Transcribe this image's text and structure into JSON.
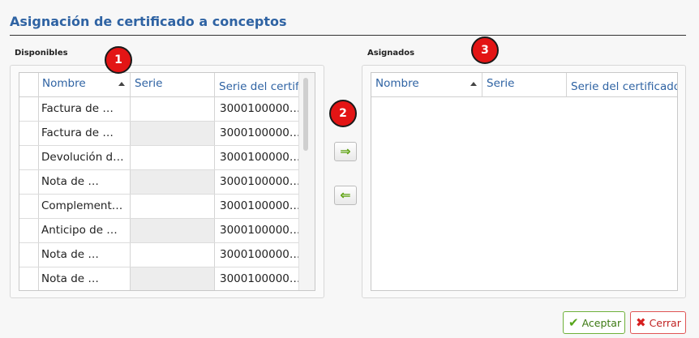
{
  "header": {
    "title": "Asignación de certificado a conceptos"
  },
  "available": {
    "label": "Disponibles",
    "columns": [
      "Nombre",
      "Serie",
      "Serie del certifi"
    ],
    "rows": [
      {
        "name": "Factura de …",
        "serie": "",
        "cert": "3000100000…"
      },
      {
        "name": "Factura de …",
        "serie": "",
        "cert": "3000100000…"
      },
      {
        "name": "Devolución d…",
        "serie": "",
        "cert": "3000100000…"
      },
      {
        "name": "Nota de …",
        "serie": "",
        "cert": "3000100000…"
      },
      {
        "name": "Complement…",
        "serie": "",
        "cert": "3000100000…"
      },
      {
        "name": "Anticipo de …",
        "serie": "",
        "cert": "3000100000…"
      },
      {
        "name": "Nota de …",
        "serie": "",
        "cert": "3000100000…"
      },
      {
        "name": "Nota de …",
        "serie": "",
        "cert": "3000100000…"
      }
    ]
  },
  "assigned": {
    "label": "Asignados",
    "columns": [
      "Nombre",
      "Serie",
      "Serie del certificado"
    ],
    "rows": []
  },
  "badges": [
    "1",
    "2",
    "3"
  ],
  "transfer": {
    "add_icon": "arrow-right-icon",
    "remove_icon": "arrow-left-icon"
  },
  "footer": {
    "accept_label": "Aceptar",
    "close_label": "Cerrar"
  },
  "colors": {
    "title": "#2f63a3",
    "badge": "#e31515",
    "accept": "#56a51a",
    "close": "#d62020"
  }
}
